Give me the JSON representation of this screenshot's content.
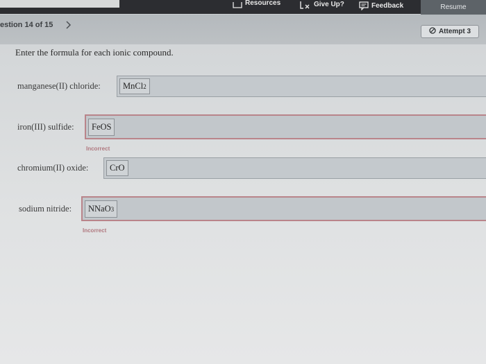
{
  "toolbar": {
    "resources_label": "Resources",
    "give_up_label": "Give Up?",
    "feedback_label": "Feedback",
    "resume_label": "Resume"
  },
  "question_bar": {
    "question_counter": "estion 14 of 15",
    "attempt_label": "Attempt 3"
  },
  "prompt": "Enter the formula for each ionic compound.",
  "compounds": [
    {
      "label": "manganese(II) chloride:",
      "answer_main": "MnCl",
      "answer_sub": "2",
      "status": ""
    },
    {
      "label": "iron(III) sulfide:",
      "answer_main": "FeOS",
      "answer_sub": "",
      "status": "Incorrect"
    },
    {
      "label": "chromium(II) oxide:",
      "answer_main": "CrO",
      "answer_sub": "",
      "status": ""
    },
    {
      "label": "sodium nitride:",
      "answer_main": "NNaO",
      "answer_sub": "3",
      "status": "Incorrect"
    }
  ],
  "colors": {
    "toolbar_bg": "#2c2d31",
    "resume_bg": "#5d6368",
    "incorrect_border": "#b9848a",
    "incorrect_text": "#b0787f"
  },
  "icons": {
    "resources": "book-icon",
    "give_up": "give-up-icon",
    "feedback": "feedback-icon",
    "next": "chevron-right-icon",
    "attempt": "circle-slash-icon"
  }
}
